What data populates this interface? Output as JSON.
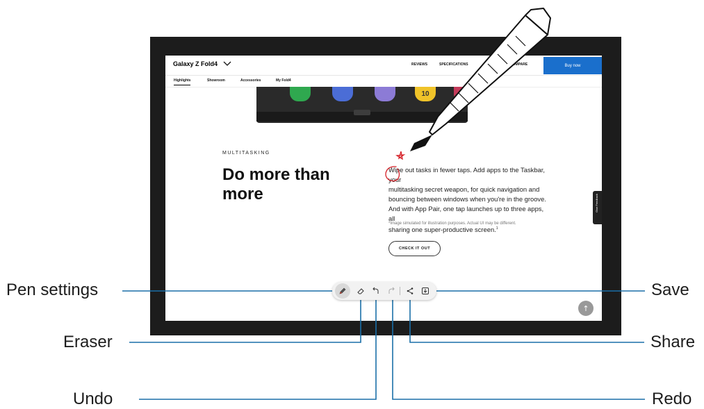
{
  "website": {
    "product_name": "Galaxy Z Fold4",
    "nav_links": [
      "REVIEWS",
      "SPECIFICATIONS",
      "COMPARE"
    ],
    "buy_button": "Buy now",
    "sub_tabs": [
      "Highlights",
      "Showroom",
      "Accessories",
      "My Fold4"
    ],
    "section_eyebrow": "MULTITASKING",
    "headline_line1": "Do more than",
    "headline_line2": "more",
    "body_lines": [
      "Wipe out tasks in fewer taps. Add apps to the Taskbar, your",
      "multitasking secret weapon, for quick navigation and",
      "bouncing between windows when you're in the groove.",
      "And with App Pair, one tap launches up to three apps, all",
      "sharing one super-productive screen."
    ],
    "footnote_marker": "1",
    "disclaimer": "*Image simulated for illustration purposes. Actual UI may be different.",
    "cta_button": "CHECK IT OUT",
    "feedback_tab": "Give Feedback",
    "calendar_day": "10"
  },
  "toolbar": {
    "tools": [
      {
        "name": "pen-settings",
        "icon": "pen-icon"
      },
      {
        "name": "eraser",
        "icon": "eraser-icon"
      },
      {
        "name": "undo",
        "icon": "undo-icon"
      },
      {
        "name": "redo",
        "icon": "redo-icon"
      },
      {
        "name": "share",
        "icon": "share-icon"
      },
      {
        "name": "save",
        "icon": "save-icon"
      }
    ]
  },
  "callouts": {
    "pen_settings": "Pen settings",
    "eraser": "Eraser",
    "undo": "Undo",
    "save": "Save",
    "share": "Share",
    "redo": "Redo"
  },
  "colors": {
    "accent_blue": "#1a6fcc",
    "annotation_red": "#d62027",
    "callout_line": "#1a6fa8"
  }
}
